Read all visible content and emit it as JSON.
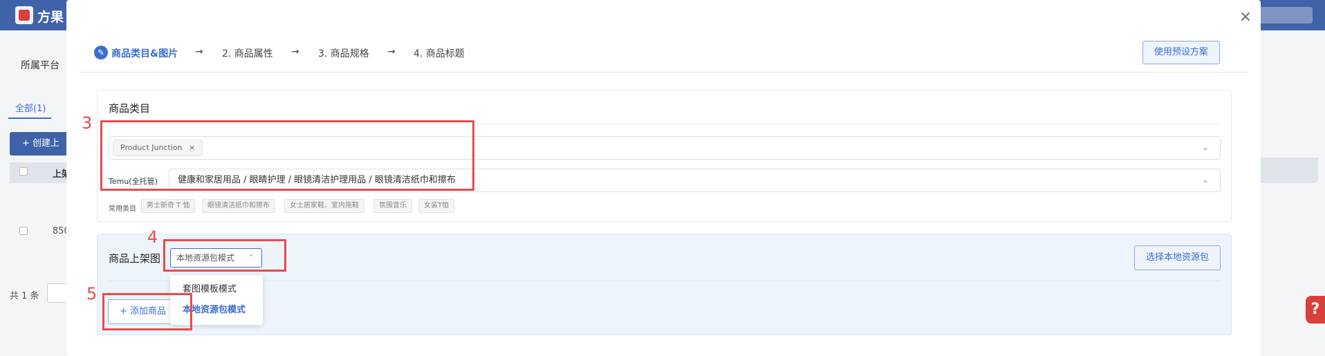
{
  "app": {
    "name": "方果"
  },
  "background": {
    "platform_label": "所属平台",
    "tab_all": "全部(1)",
    "create_button": "+ 创建上",
    "table_header_col": "上架",
    "row_number": "850",
    "total": "共 1 条"
  },
  "help": {
    "label": "?"
  },
  "modal": {
    "close": "×",
    "steps": [
      {
        "label": "商品类目&图片"
      },
      {
        "label": "2. 商品属性"
      },
      {
        "label": "3. 商品规格"
      },
      {
        "label": "4. 商品标题"
      }
    ],
    "step_arrow": "→",
    "preset_button": "使用预设方案",
    "category": {
      "title": "商品类目",
      "store_tag": "Product Junction",
      "tag_remove": "×",
      "platform_label": "Temu(全托管)",
      "category_path": "健康和家居用品 / 眼睛护理 / 眼镜清洁护理用品 / 眼镜清洁纸巾和擦布",
      "common_label": "常用类目",
      "common_chips": [
        "男士新奇 T 恤",
        "眼镜清洁纸巾和擦布",
        "女士居家鞋、室内拖鞋",
        "氛围音乐",
        "女装T恤"
      ]
    },
    "images": {
      "title": "商品上架图",
      "mode_select_value": "本地资源包模式",
      "mode_options": [
        {
          "label": "套图模板模式",
          "selected": false
        },
        {
          "label": "本地资源包模式",
          "selected": true
        }
      ],
      "choose_package_button": "选择本地资源包",
      "add_product_button": "添加商品",
      "add_icon": "+"
    }
  },
  "annotations": {
    "n3": "3",
    "n4": "4",
    "n5": "5"
  },
  "icons": {
    "chevron_down": "⌄",
    "chevron_up": "⌃",
    "edit": "✎"
  },
  "colors": {
    "accent": "#3a6fd1",
    "highlight": "#e84b4b",
    "topbar": "#3f63a8"
  }
}
